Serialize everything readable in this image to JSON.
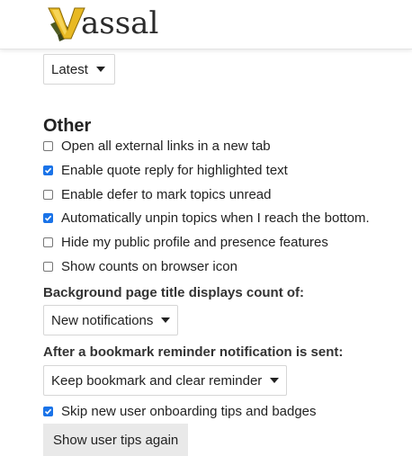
{
  "header": {
    "logo_text": "assal",
    "logo_letter": "V"
  },
  "theme_select": {
    "value": "Latest"
  },
  "other": {
    "title": "Other",
    "options": [
      {
        "label": "Open all external links in a new tab",
        "checked": false
      },
      {
        "label": "Enable quote reply for highlighted text",
        "checked": true
      },
      {
        "label": "Enable defer to mark topics unread",
        "checked": false
      },
      {
        "label": "Automatically unpin topics when I reach the bottom.",
        "checked": true
      },
      {
        "label": "Hide my public profile and presence features",
        "checked": false
      },
      {
        "label": "Show counts on browser icon",
        "checked": false
      }
    ]
  },
  "title_count": {
    "label": "Background page title displays count of:",
    "value": "New notifications"
  },
  "bookmark": {
    "label": "After a bookmark reminder notification is sent:",
    "value": "Keep bookmark and clear reminder"
  },
  "onboarding": {
    "label": "Skip new user onboarding tips and badges",
    "checked": true
  },
  "tips_button": {
    "label": "Show user tips again"
  },
  "colors": {
    "checkbox_accent": "#1a73e8",
    "button_bg": "#e9e9e9",
    "logo_gold": "#e8b923",
    "logo_green": "#5a6b2a"
  }
}
